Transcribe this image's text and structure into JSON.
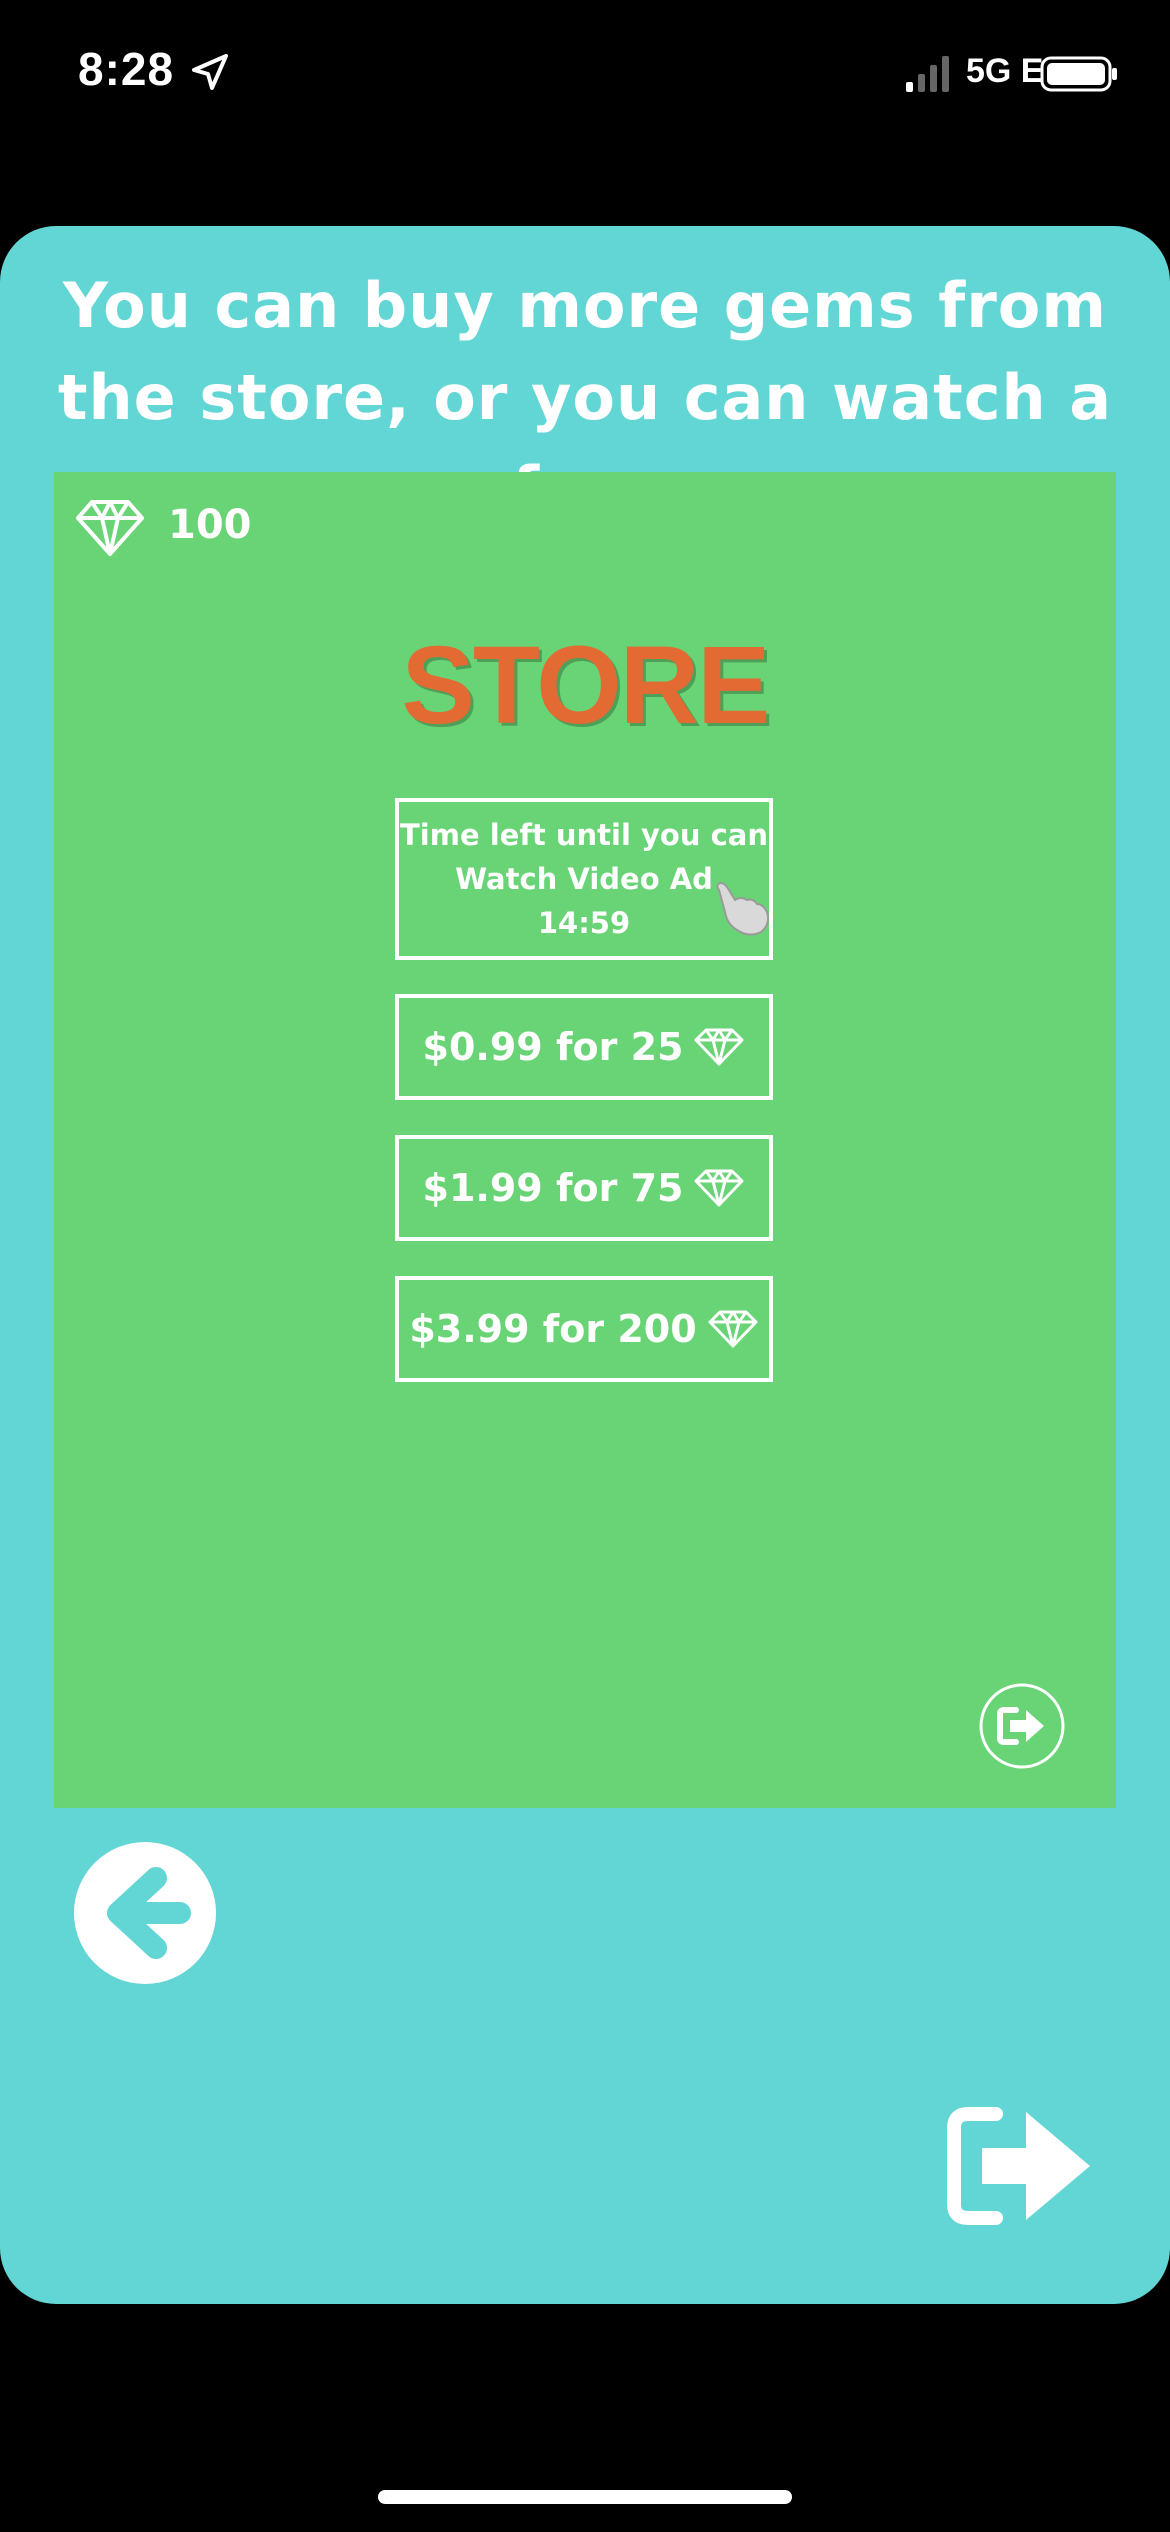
{
  "status_bar": {
    "time": "8:28",
    "network": "5G E",
    "icons": [
      "location-arrow-icon",
      "signal-icon",
      "battery-icon"
    ]
  },
  "instruction_text": "You can buy more gems from the store, or you can watch a free",
  "store": {
    "gem_count": "100",
    "title": "STORE",
    "ad_button": {
      "line1": "Time left until you can",
      "line2": "Watch Video Ad",
      "timer": "14:59"
    },
    "offers": [
      {
        "label": "$0.99 for 25"
      },
      {
        "label": "$1.99 for 75"
      },
      {
        "label": "$3.99 for 200"
      }
    ]
  },
  "colors": {
    "card_bg": "#62d6d4",
    "panel_bg": "#68d475",
    "title": "#e36a33",
    "text": "#ffffff"
  }
}
